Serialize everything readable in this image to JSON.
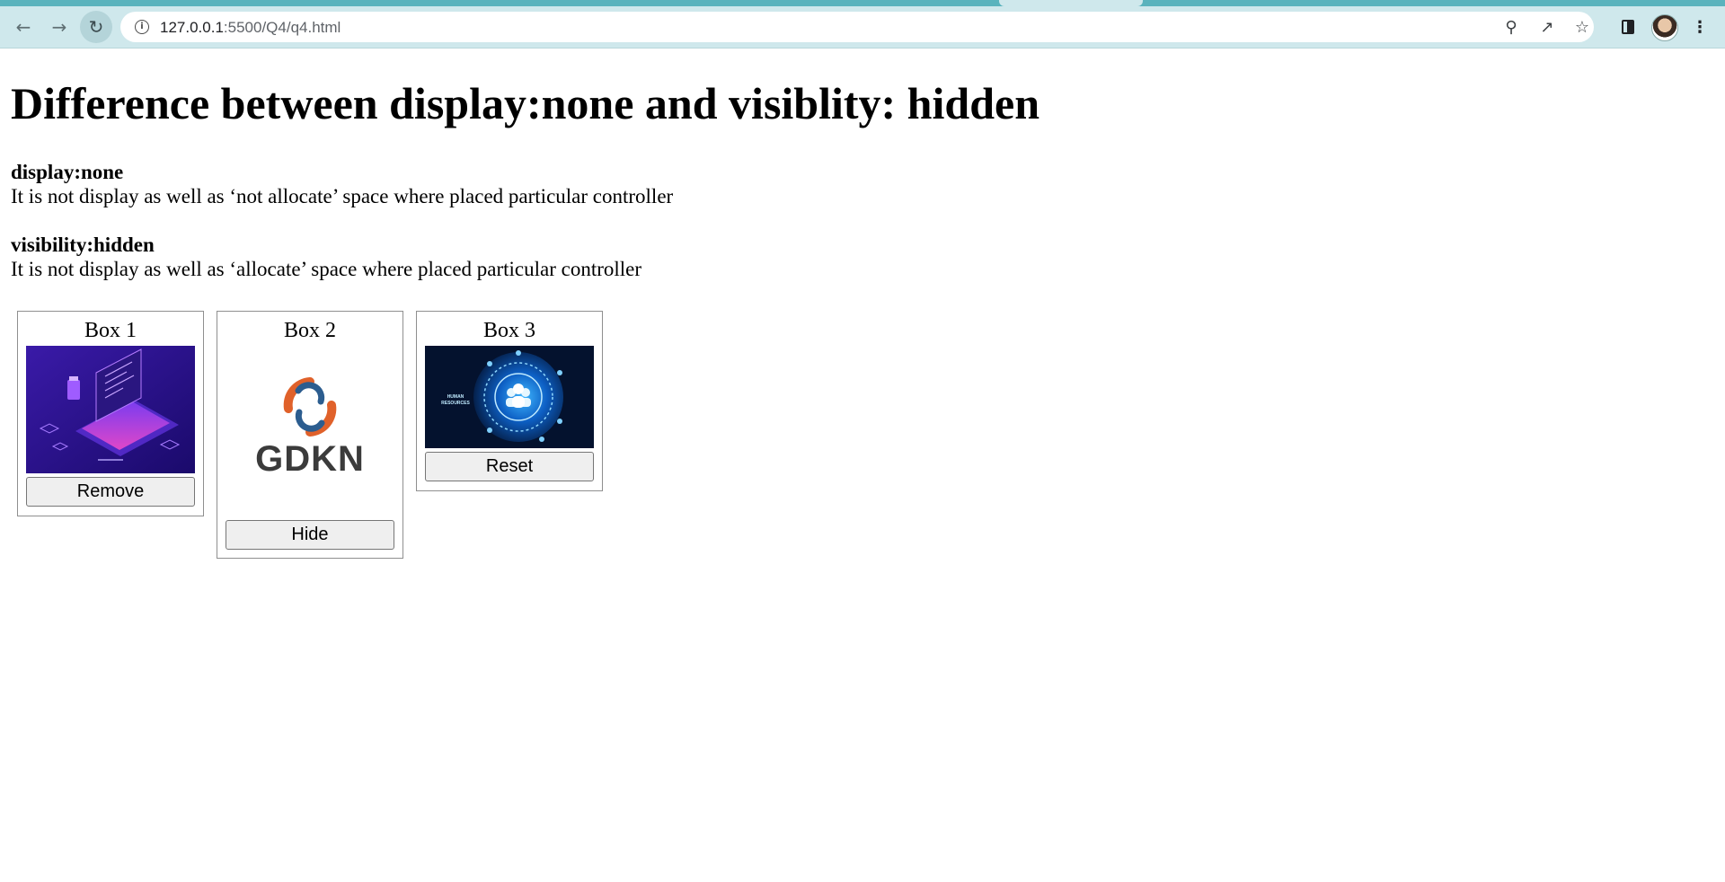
{
  "browser": {
    "url_host": "127.0.0.1",
    "url_path": ":5500/Q4/q4.html"
  },
  "page": {
    "heading": "Difference between display:none and visiblity: hidden",
    "sections": [
      {
        "term": "display:none",
        "description": "It is not display as well as ‘not allocate’ space where placed particular controller"
      },
      {
        "term": "visibility:hidden",
        "description": "It is not display as well as ‘allocate’ space where placed particular controller"
      }
    ]
  },
  "boxes": [
    {
      "title": "Box 1",
      "button": "Remove",
      "image": "isometric-laptop-illustration"
    },
    {
      "title": "Box 2",
      "button": "Hide",
      "image": "gdkn-logo",
      "logo_text": "GDKN"
    },
    {
      "title": "Box 3",
      "button": "Reset",
      "image": "human-resources-illustration",
      "image_caption": "HUMAN RESOURCES"
    }
  ],
  "colors": {
    "chrome": "#cfe8ec",
    "tabstrip": "#5ab3bd",
    "button_bg": "#efefef",
    "box_border": "#8f8f8f",
    "logo_orange": "#e0612a",
    "logo_blue": "#2c5d8f"
  }
}
